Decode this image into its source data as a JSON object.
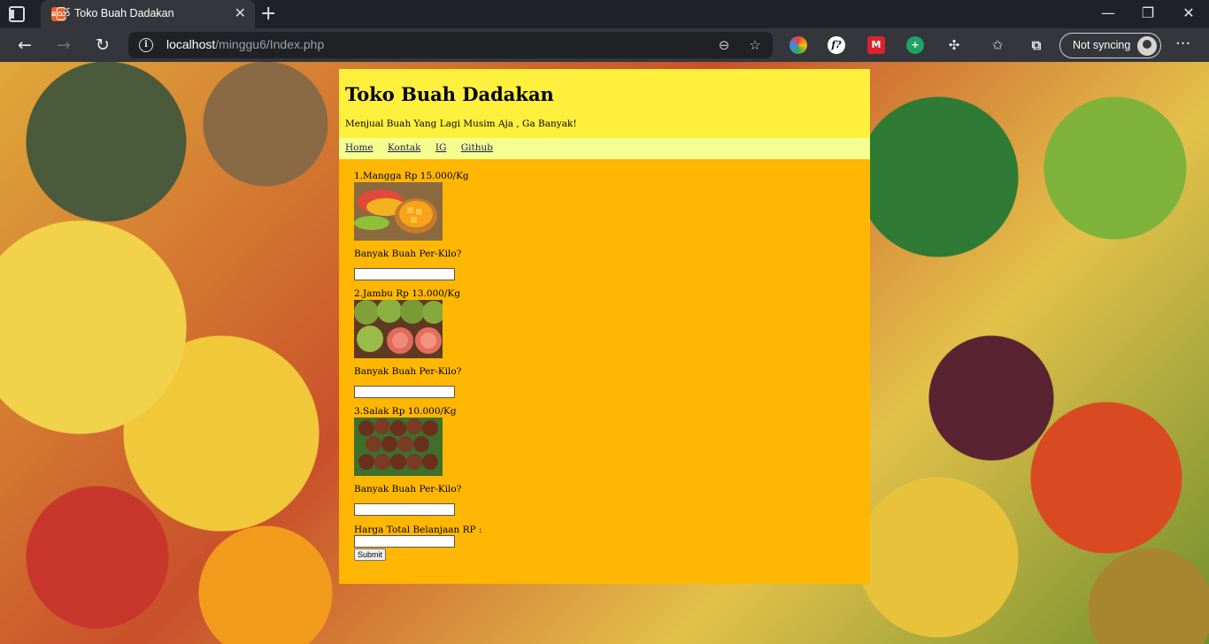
{
  "browser": {
    "tab_title": "Toko Buah Dadakan",
    "url_host": "localhost",
    "url_path": "/minggu6/Index.php",
    "sync_label": "Not syncing"
  },
  "page": {
    "title": "Toko Buah Dadakan",
    "subtitle": "Menjual Buah Yang Lagi Musim Aja , Ga Banyak!",
    "menu": [
      "Home",
      "Kontak",
      "IG",
      "Github"
    ],
    "fruits": [
      {
        "label": "1.Mangga Rp 15.000/Kg",
        "image": "mango-photo",
        "qty_label": "Banyak Buah Per-Kilo?",
        "qty_value": ""
      },
      {
        "label": "2.Jambu Rp 13.000/Kg",
        "image": "guava-photo",
        "qty_label": "Banyak Buah Per-Kilo?",
        "qty_value": ""
      },
      {
        "label": "3.Salak Rp 10.000/Kg",
        "image": "salak-photo",
        "qty_label": "Banyak Buah Per-Kilo?",
        "qty_value": ""
      }
    ],
    "total_label": "Harga Total Belanjaan RP :",
    "total_value": "",
    "submit_label": "Submit"
  },
  "colors": {
    "header_bg": "#fff03e",
    "menu_bg": "#f5ff8f",
    "content_bg": "#ffb703"
  }
}
